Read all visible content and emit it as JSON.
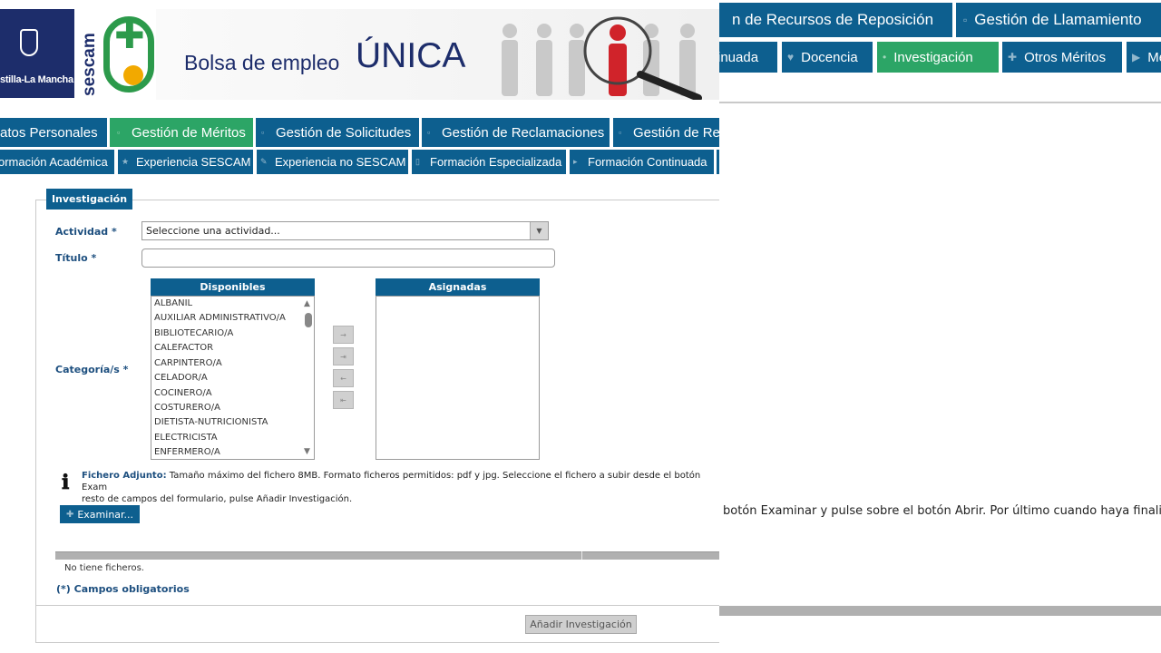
{
  "banner": {
    "org_name": "Castilla-La Mancha",
    "org_name_visible": "stilla-La Mancha",
    "brand": "sescam",
    "title_prefix": "Bolsa de empleo",
    "title_main": "ÚNICA"
  },
  "nav_primary": [
    {
      "label": "atos Personales",
      "active": false
    },
    {
      "label": "Gestión de Méritos",
      "active": true
    },
    {
      "label": "Gestión de Solicitudes",
      "active": false
    },
    {
      "label": "Gestión de Reclamaciones",
      "active": false
    },
    {
      "label": "Gestión de Rec",
      "active": false
    }
  ],
  "nav_secondary": [
    {
      "label": "ormación Académica",
      "active": false
    },
    {
      "label": "Experiencia SESCAM",
      "active": false
    },
    {
      "label": "Experiencia no SESCAM",
      "active": false
    },
    {
      "label": "Formación Especializada",
      "active": false
    },
    {
      "label": "Formación Continuada",
      "active": false
    }
  ],
  "form": {
    "legend": "Investigación",
    "actividad_label": "Actividad *",
    "actividad_value": "Seleccione una actividad...",
    "titulo_label": "Título *",
    "titulo_value": "",
    "categorias_label": "Categoría/s *",
    "disponibles_header": "Disponibles",
    "asignadas_header": "Asignadas",
    "disponibles": [
      "ALBANIL",
      "AUXILIAR ADMINISTRATIVO/A",
      "BIBLIOTECARIO/A",
      "CALEFACTOR",
      "CARPINTERO/A",
      "CELADOR/A",
      "COCINERO/A",
      "COSTURERO/A",
      "DIETISTA-NUTRICIONISTA",
      "ELECTRICISTA",
      "ENFERMERO/A"
    ],
    "asignadas": [],
    "move_buttons": [
      "→",
      "⇥",
      "←",
      "⇤"
    ],
    "info_label": "Fichero Adjunto:",
    "info_text": " Tamaño máximo del fichero 8MB. Formato ficheros permitidos: pdf y jpg. Seleccione el fichero a subir desde el botón Exam",
    "info_text_line2": "resto de campos del formulario, pulse Añadir Investigación.",
    "examinar_label": "Examinar...",
    "no_files": "No tiene ficheros.",
    "required_note": "(*) Campos obligatorios",
    "submit_label": "Añadir Investigación"
  },
  "zoom": {
    "nav_top": [
      {
        "label": "n de Recursos de Reposición",
        "active": false
      },
      {
        "label": "Gestión de Llamamiento",
        "active": false
      }
    ],
    "nav_bottom": [
      {
        "label": "inuada",
        "active": false
      },
      {
        "label": "Docencia",
        "active": false
      },
      {
        "label": "Investigación",
        "active": true
      },
      {
        "label": "Otros Méritos",
        "active": false
      },
      {
        "label": "Me",
        "active": false
      }
    ],
    "info_text": "botón Examinar y pulse sobre el botón Abrir. Por último cuando haya finalizado"
  },
  "colors": {
    "nav_blue": "#0d5f8f",
    "nav_active_green": "#2ca566",
    "label_blue": "#1d4f7f",
    "brand_navy": "#1d2d6b",
    "brand_green": "#2c9a4b",
    "brand_yellow": "#f2a900",
    "person_red": "#d0232a"
  },
  "icons": {
    "info": "info-icon",
    "examinar": "plus-icon",
    "nav": "page-icon"
  }
}
